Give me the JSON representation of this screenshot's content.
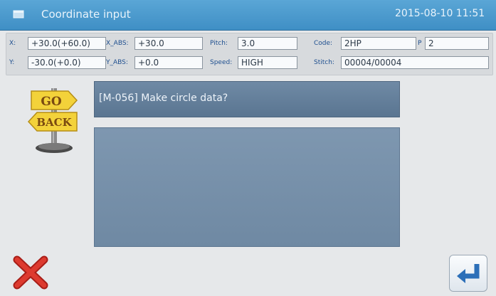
{
  "window": {
    "title": "Coordinate input",
    "datetime": "2015-08-10 11:51"
  },
  "info": {
    "x_label": "X:",
    "x_value": "+30.0(+60.0)",
    "x_abs_label": "X_ABS:",
    "x_abs_value": "+30.0",
    "pitch_label": "Pitch:",
    "pitch_value": "3.0",
    "code_label": "Code:",
    "code_value": "2HP",
    "p_label": "P",
    "p_value": "2",
    "y_label": "Y:",
    "y_value": "-30.0(+0.0)",
    "y_abs_label": "Y_ABS:",
    "y_abs_value": "+0.0",
    "speed_label": "Speed:",
    "speed_value": "HIGH",
    "stitch_label": "Stitch:",
    "stitch_value": "00004/00004"
  },
  "go_back_sign": {
    "go_text": "GO",
    "back_text": "BACK",
    "icon": "go-back-signpost-icon",
    "colors": {
      "sign": "#f3d23a",
      "text": "#7a4a10",
      "pole": "#7a7a7a"
    }
  },
  "message": {
    "text": "[M-056] Make circle data?"
  },
  "buttons": {
    "cancel_icon": "red-x-icon",
    "enter_icon": "enter-arrow-icon"
  },
  "colors": {
    "titlebar": "#4a98cb",
    "message_bg": "#6680a0",
    "content_bg": "#7890aa",
    "cancel_red": "#d42b24",
    "enter_blue": "#2c6fb8"
  }
}
